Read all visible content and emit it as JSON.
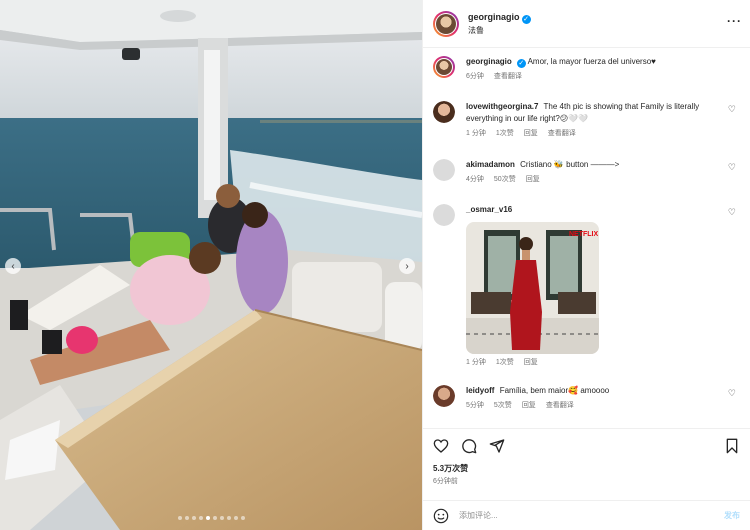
{
  "post": {
    "username": "georginagio",
    "location": "法鲁",
    "caption": "Amor, la mayor fuerza del universo♥",
    "caption_time": "6分钟",
    "view_translation": "查看翻译"
  },
  "comments": [
    {
      "user": "lovewithgeorgina.7",
      "text": "The 4th pic is showing that Family is literally everything in our life right?😕🤍🤍",
      "time": "1 分钟",
      "likes": "1次赞",
      "reply": "回复",
      "translate": "查看翻译"
    },
    {
      "user": "akimadamon",
      "text": "Cristiano 🐝 button ———>",
      "time": "4分钟",
      "likes": "50次赞",
      "reply": "回复"
    },
    {
      "user": "_osmar_v16",
      "text": "",
      "time": "1 分钟",
      "likes": "1次赞",
      "reply": "回复",
      "thumb_badge": "NETFLIX"
    },
    {
      "user": "leidyoff",
      "text": "Família, bem maior🥰 amoooo",
      "time": "5分钟",
      "likes": "5次赞",
      "reply": "回复",
      "translate": "查看翻译"
    }
  ],
  "actions": {
    "likes": "5.3万次赞",
    "posted_ago": "6分钟前"
  },
  "composer": {
    "placeholder": "添加评论...",
    "send": "发布"
  },
  "carousel": {
    "current": 5,
    "total": 10
  },
  "icons": [
    "heart-icon",
    "comment-icon",
    "share-icon",
    "bookmark-icon",
    "emoji-icon",
    "more-icon",
    "verified-icon"
  ],
  "colors": {
    "accent": "#0095f6",
    "muted": "#737373",
    "send_disabled": "#b2dffc"
  }
}
